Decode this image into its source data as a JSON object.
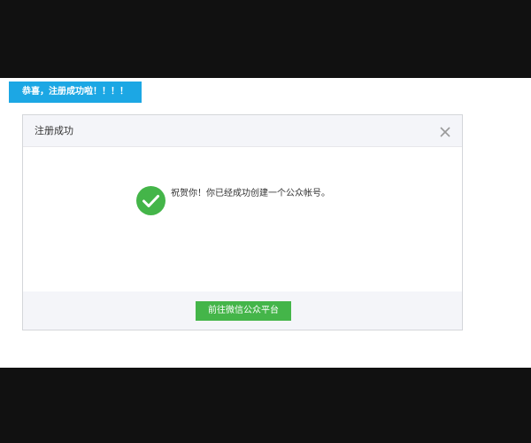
{
  "toast": {
    "text": "恭喜，注册成功啦！！！！"
  },
  "dialog": {
    "title": "注册成功",
    "close_icon": "close-icon",
    "success_icon": "check-circle-icon",
    "message": "祝贺你！你已经成功创建一个公众帐号。",
    "primary_button_label": "前往微信公众平台"
  },
  "colors": {
    "toast_bg": "#1ca7e4",
    "success_green": "#44b549",
    "header_bg": "#f4f5f9"
  }
}
